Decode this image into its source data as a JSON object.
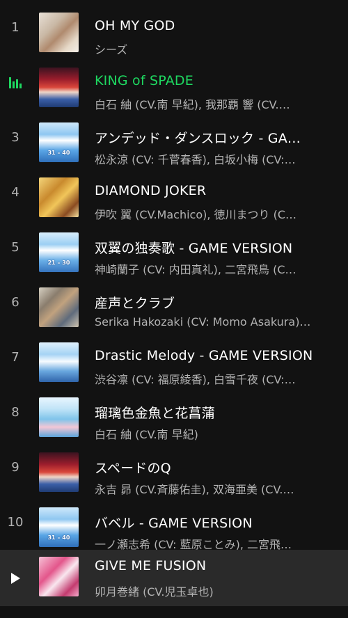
{
  "tracks": [
    {
      "num": "1",
      "title": "OH MY GOD",
      "artist": "シーズ",
      "cover_label": ""
    },
    {
      "num": "",
      "title": "KING of SPADE",
      "artist": "白石 紬 (CV.南 早紀), 我那覇 響 (CV.…",
      "cover_label": ""
    },
    {
      "num": "3",
      "title": "アンデッド・ダンスロック - GA…",
      "artist": "松永涼 (CV: 千菅春香), 白坂小梅 (CV:…",
      "cover_label": "31 – 40"
    },
    {
      "num": "4",
      "title": "DIAMOND JOKER",
      "artist": "伊吹 翼 (CV.Machico), 徳川まつり (C…",
      "cover_label": ""
    },
    {
      "num": "5",
      "title": "双翼の独奏歌 - GAME VERSION",
      "artist": "神崎蘭子 (CV: 内田真礼), 二宮飛鳥 (C…",
      "cover_label": "21 – 30"
    },
    {
      "num": "6",
      "title": "産声とクラブ",
      "artist": "Serika Hakozaki (CV: Momo Asakura)…",
      "cover_label": ""
    },
    {
      "num": "7",
      "title": "Drastic Melody - GAME VERSION",
      "artist": "渋谷凛 (CV: 福原綾香), 白雪千夜 (CV:…",
      "cover_label": ""
    },
    {
      "num": "8",
      "title": "瑠璃色金魚と花菖蒲",
      "artist": "白石 紬 (CV.南 早紀)",
      "cover_label": ""
    },
    {
      "num": "9",
      "title": "スペードのQ",
      "artist": "永吉 昴 (CV.斉藤佑圭), 双海亜美 (CV.…",
      "cover_label": ""
    },
    {
      "num": "10",
      "title": "バベル - GAME VERSION",
      "artist": "一ノ瀬志希 (CV: 藍原ことみ), 二宮飛…",
      "cover_label": "31 – 40"
    },
    {
      "num": "",
      "title": "GIVE ME FUSION",
      "artist": "卯月巻緒 (CV.児玉卓也)",
      "cover_label": ""
    }
  ],
  "colors": {
    "accent": "#1ed760",
    "background": "#121212",
    "hover_row": "#2a2a2a",
    "secondary_text": "#b3b3b3"
  },
  "icons": {
    "row2": "equalizer-icon",
    "row11": "play-icon"
  }
}
